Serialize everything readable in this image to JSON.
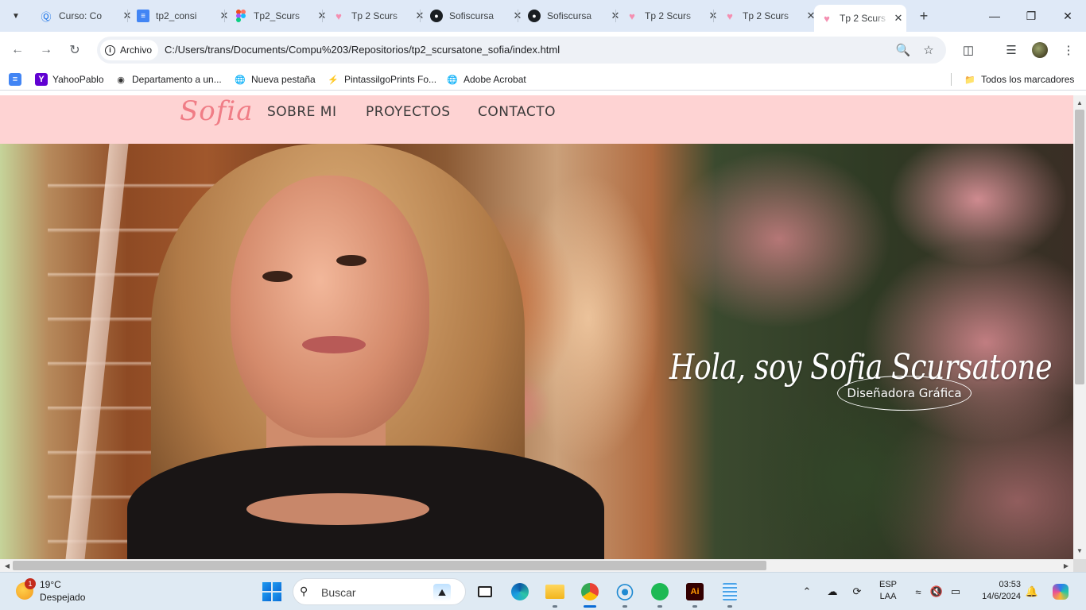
{
  "browser": {
    "tabs": [
      {
        "title": "Curso: Co",
        "icon": "globe-c-icon",
        "active": false
      },
      {
        "title": "tp2_consi",
        "icon": "docs-icon",
        "active": false
      },
      {
        "title": "Tp2_Scurs",
        "icon": "figma-icon",
        "active": false
      },
      {
        "title": "Tp 2 Scurs",
        "icon": "pink-heart-icon",
        "active": false
      },
      {
        "title": "Sofiscursa",
        "icon": "github-icon",
        "active": false
      },
      {
        "title": "Sofiscursa",
        "icon": "github-icon",
        "active": false
      },
      {
        "title": "Tp 2 Scurs",
        "icon": "pink-heart-icon",
        "active": false
      },
      {
        "title": "Tp 2 Scurs",
        "icon": "pink-heart-icon",
        "active": false
      },
      {
        "title": "Tp 2 Scurs",
        "icon": "pink-heart-icon",
        "active": true
      }
    ],
    "address": {
      "chip_label": "Archivo",
      "url": "C:/Users/trans/Documents/Compu%203/Repositorios/tp2_scursatone_sofia/index.html"
    },
    "bookmarks": [
      {
        "label": "",
        "icon": "docs-icon"
      },
      {
        "label": "YahooPablo",
        "icon": "yahoo-icon"
      },
      {
        "label": "Departamento a un...",
        "icon": "airbnb-icon"
      },
      {
        "label": "Nueva pestaña",
        "icon": "globe-icon"
      },
      {
        "label": "PintassilgoPrints Fo...",
        "icon": "bolt-icon"
      },
      {
        "label": "Adobe Acrobat",
        "icon": "globe-icon"
      }
    ],
    "all_bookmarks_label": "Todos los marcadores"
  },
  "site": {
    "logo": "Sofia",
    "nav": [
      "SOBRE MI",
      "PROYECTOS",
      "CONTACTO"
    ],
    "hero": {
      "title": "Hola, soy Sofia Scursatone",
      "badge": "Diseñadora Gráfica"
    },
    "colors": {
      "nav_bg": "#fed3d3",
      "logo": "#f07d86"
    }
  },
  "taskbar": {
    "weather": {
      "temp": "19°C",
      "desc": "Despejado",
      "badge": "1"
    },
    "search_label": "Buscar",
    "lang": {
      "line1": "ESP",
      "line2": "LAA"
    },
    "clock": {
      "time": "03:53",
      "date": "14/6/2024"
    }
  }
}
